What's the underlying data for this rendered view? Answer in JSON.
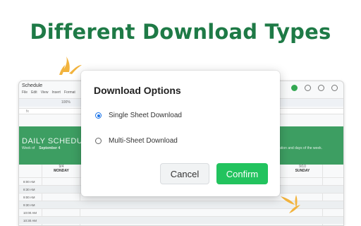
{
  "headline": "Different Download Types",
  "spreadsheet": {
    "title": "Schedule",
    "menu": [
      "File",
      "Edit",
      "View",
      "Insert",
      "Format"
    ],
    "zoom": "100%",
    "formula_label": "fx",
    "banner_title": "DAILY SCHEDULE",
    "week_label": "Week of",
    "week_value": "September 4",
    "banner_note": "...ation and days of the week.",
    "days": [
      {
        "date": "9/4",
        "name": "MONDAY"
      },
      {
        "date": "9/10",
        "name": "SUNDAY"
      }
    ],
    "times": [
      "8:00 AM",
      "8:30 AM",
      "9:00 AM",
      "9:30 AM",
      "10:00 AM",
      "10:30 AM"
    ]
  },
  "dialog": {
    "title": "Download Options",
    "options": [
      {
        "label": "Single Sheet Download",
        "selected": true
      },
      {
        "label": "Multi-Sheet Download",
        "selected": false
      }
    ],
    "cancel_label": "Cancel",
    "confirm_label": "Confirm"
  },
  "colors": {
    "headline": "#1e7a46",
    "banner": "#3d9e62",
    "confirm": "#22c35e",
    "radio_selected": "#1a73e8",
    "sparkle": "#f2b33d"
  }
}
